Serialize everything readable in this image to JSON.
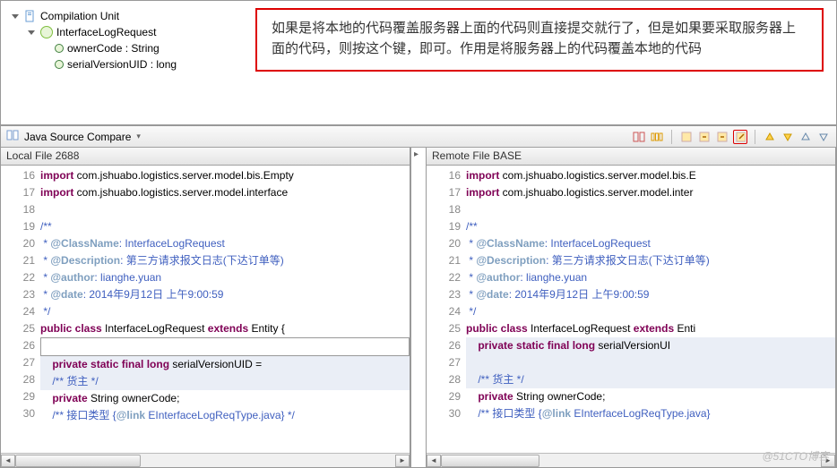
{
  "tree": {
    "root": "Compilation Unit",
    "iface": "InterfaceLogRequest",
    "field1": "ownerCode : String",
    "field2": "serialVersionUID : long"
  },
  "annotation": "如果是将本地的代码覆盖服务器上面的代码则直接提交就行了，但是如果要采取服务器上面的代码，则按这个键，即可。作用是将服务器上的代码覆盖本地的代码",
  "compare_title": "Java Source Compare",
  "left": {
    "header": "Local File 2688",
    "lines": [
      {
        "n": 16,
        "h": "<span class='kw'>import</span> com.jshuabo.logistics.server.model.bis.Empty"
      },
      {
        "n": 17,
        "h": "<span class='kw'>import</span> com.jshuabo.logistics.server.model.interface"
      },
      {
        "n": 18,
        "h": ""
      },
      {
        "n": 19,
        "h": "<span class='cmt'>/**</span>"
      },
      {
        "n": 20,
        "h": "<span class='cmt'> * <span class='cmt-tag'>@ClassName</span>: InterfaceLogRequest</span>"
      },
      {
        "n": 21,
        "h": "<span class='cmt'> * <span class='cmt-tag'>@Description</span>: 第三方请求报文日志(下达订单等)</span>"
      },
      {
        "n": 22,
        "h": "<span class='cmt'> * <span class='cmt-tag'>@author</span>: lianghe.yuan</span>"
      },
      {
        "n": 23,
        "h": "<span class='cmt'> * <span class='cmt-tag'>@date</span>: 2014年9月12日 上午9:00:59</span>"
      },
      {
        "n": 24,
        "h": "<span class='cmt'> */</span>"
      },
      {
        "n": 25,
        "h": "<span class='kw'>public class</span> InterfaceLogRequest <span class='kw'>extends</span> Entity {"
      },
      {
        "n": 26,
        "h": "",
        "cursor": true
      },
      {
        "n": 27,
        "h": "    <span class='kw'>private static final long</span> serialVersionUID = ",
        "diff": true
      },
      {
        "n": 28,
        "h": "    <span class='cmt'>/** 货主 */</span>",
        "diff": true
      },
      {
        "n": 29,
        "h": "    <span class='kw'>private</span> String ownerCode;"
      },
      {
        "n": 30,
        "h": "    <span class='cmt'>/** 接口类型 {<span class='cmt-tag'>@link</span> EInterfaceLogReqType.java} */</span>"
      }
    ]
  },
  "right": {
    "header": "Remote File BASE",
    "lines": [
      {
        "n": 16,
        "h": "<span class='kw'>import</span> com.jshuabo.logistics.server.model.bis.E"
      },
      {
        "n": 17,
        "h": "<span class='kw'>import</span> com.jshuabo.logistics.server.model.inter"
      },
      {
        "n": 18,
        "h": ""
      },
      {
        "n": 19,
        "h": "<span class='cmt'>/**</span>"
      },
      {
        "n": 20,
        "h": "<span class='cmt'> * <span class='cmt-tag'>@ClassName</span>: InterfaceLogRequest</span>"
      },
      {
        "n": 21,
        "h": "<span class='cmt'> * <span class='cmt-tag'>@Description</span>: 第三方请求报文日志(下达订单等)</span>"
      },
      {
        "n": 22,
        "h": "<span class='cmt'> * <span class='cmt-tag'>@author</span>: lianghe.yuan</span>"
      },
      {
        "n": 23,
        "h": "<span class='cmt'> * <span class='cmt-tag'>@date</span>: 2014年9月12日 上午9:00:59</span>"
      },
      {
        "n": 24,
        "h": "<span class='cmt'> */</span>"
      },
      {
        "n": 25,
        "h": "<span class='kw'>public class</span> InterfaceLogRequest <span class='kw'>extends</span> Enti"
      },
      {
        "n": 26,
        "h": "    <span class='kw'>private static final long</span> serialVersionUI",
        "diff": true
      },
      {
        "n": 27,
        "h": "",
        "diff": true
      },
      {
        "n": 28,
        "h": "    <span class='cmt'>/** 货主 */</span>",
        "diff": true
      },
      {
        "n": 29,
        "h": "    <span class='kw'>private</span> String ownerCode;"
      },
      {
        "n": 30,
        "h": "    <span class='cmt'>/** 接口类型 {<span class='cmt-tag'>@link</span> EInterfaceLogReqType.java}</span>"
      }
    ]
  },
  "watermark": "@51CTO博客"
}
